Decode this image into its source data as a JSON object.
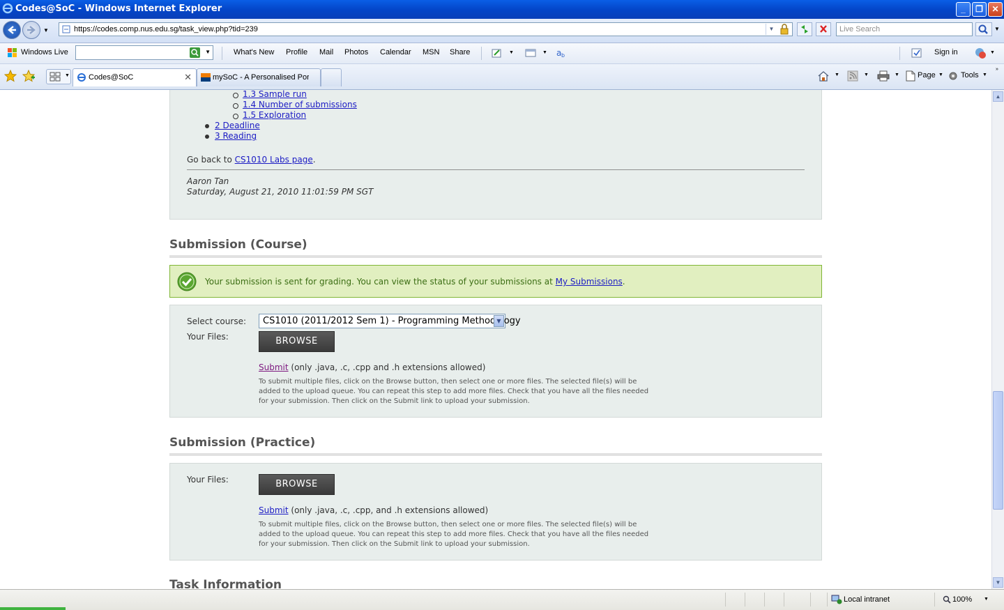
{
  "window": {
    "title": "Codes@SoC - Windows Internet Explorer"
  },
  "address": {
    "url": "https://codes.comp.nus.edu.sg/task_view.php?tid=239",
    "search_placeholder": "Live Search"
  },
  "live_toolbar": {
    "brand": "Windows Live",
    "links": [
      "What's New",
      "Profile",
      "Mail",
      "Photos",
      "Calendar",
      "MSN",
      "Share"
    ],
    "sign_in": "Sign in"
  },
  "tabs": [
    {
      "label": "Codes@SoC",
      "active": true
    },
    {
      "label": "mySoC - A Personalised Port...",
      "active": false
    }
  ],
  "command_bar": {
    "page": "Page",
    "tools": "Tools"
  },
  "toc": {
    "subitems": [
      "1.3 Sample run",
      "1.4 Number of submissions",
      "1.5 Exploration"
    ],
    "items": [
      "2 Deadline",
      "3 Reading"
    ]
  },
  "goback": {
    "prefix": "Go back to ",
    "link": "CS1010 Labs page",
    "suffix": "."
  },
  "author": {
    "name": "Aaron Tan",
    "date": "Saturday, August 21, 2010 11:01:59 PM SGT"
  },
  "course_section": {
    "title": "Submission (Course)",
    "success_message": "Your submission is sent for grading. You can view the status of your submissions at ",
    "success_link": "My Submissions",
    "success_suffix": ".",
    "select_label": "Select course:",
    "selected_course": "CS1010 (2011/2012 Sem 1) - Programming Methodology",
    "files_label": "Your Files:",
    "browse_label": "BROWSE",
    "submit_link": "Submit",
    "submit_note": " (only .java, .c, .cpp and .h extensions allowed)",
    "help_text": "To submit multiple files, click on the Browse button, then select one or more files. The selected file(s) will be added to the upload queue. You can repeat this step to add more files. Check that you have all the files needed for your submission. Then click on the Submit link to upload your submission."
  },
  "practice_section": {
    "title": "Submission (Practice)",
    "files_label": "Your Files:",
    "browse_label": "BROWSE",
    "submit_link": "Submit",
    "submit_note": " (only .java, .c, .cpp, and .h extensions allowed)",
    "help_text": "To submit multiple files, click on the Browse button, then select one or more files. The selected file(s) will be added to the upload queue. You can repeat this step to add more files. Check that you have all the files needed for your submission. Then click on the Submit link to upload your submission."
  },
  "task_info": {
    "title": "Task Information"
  },
  "status": {
    "zone": "Local intranet",
    "zoom": "100%"
  },
  "colors": {
    "link": "#1c1cc4",
    "visited": "#7e1a80",
    "success_bg": "#e1efc0",
    "box_bg": "#e8eeec"
  }
}
